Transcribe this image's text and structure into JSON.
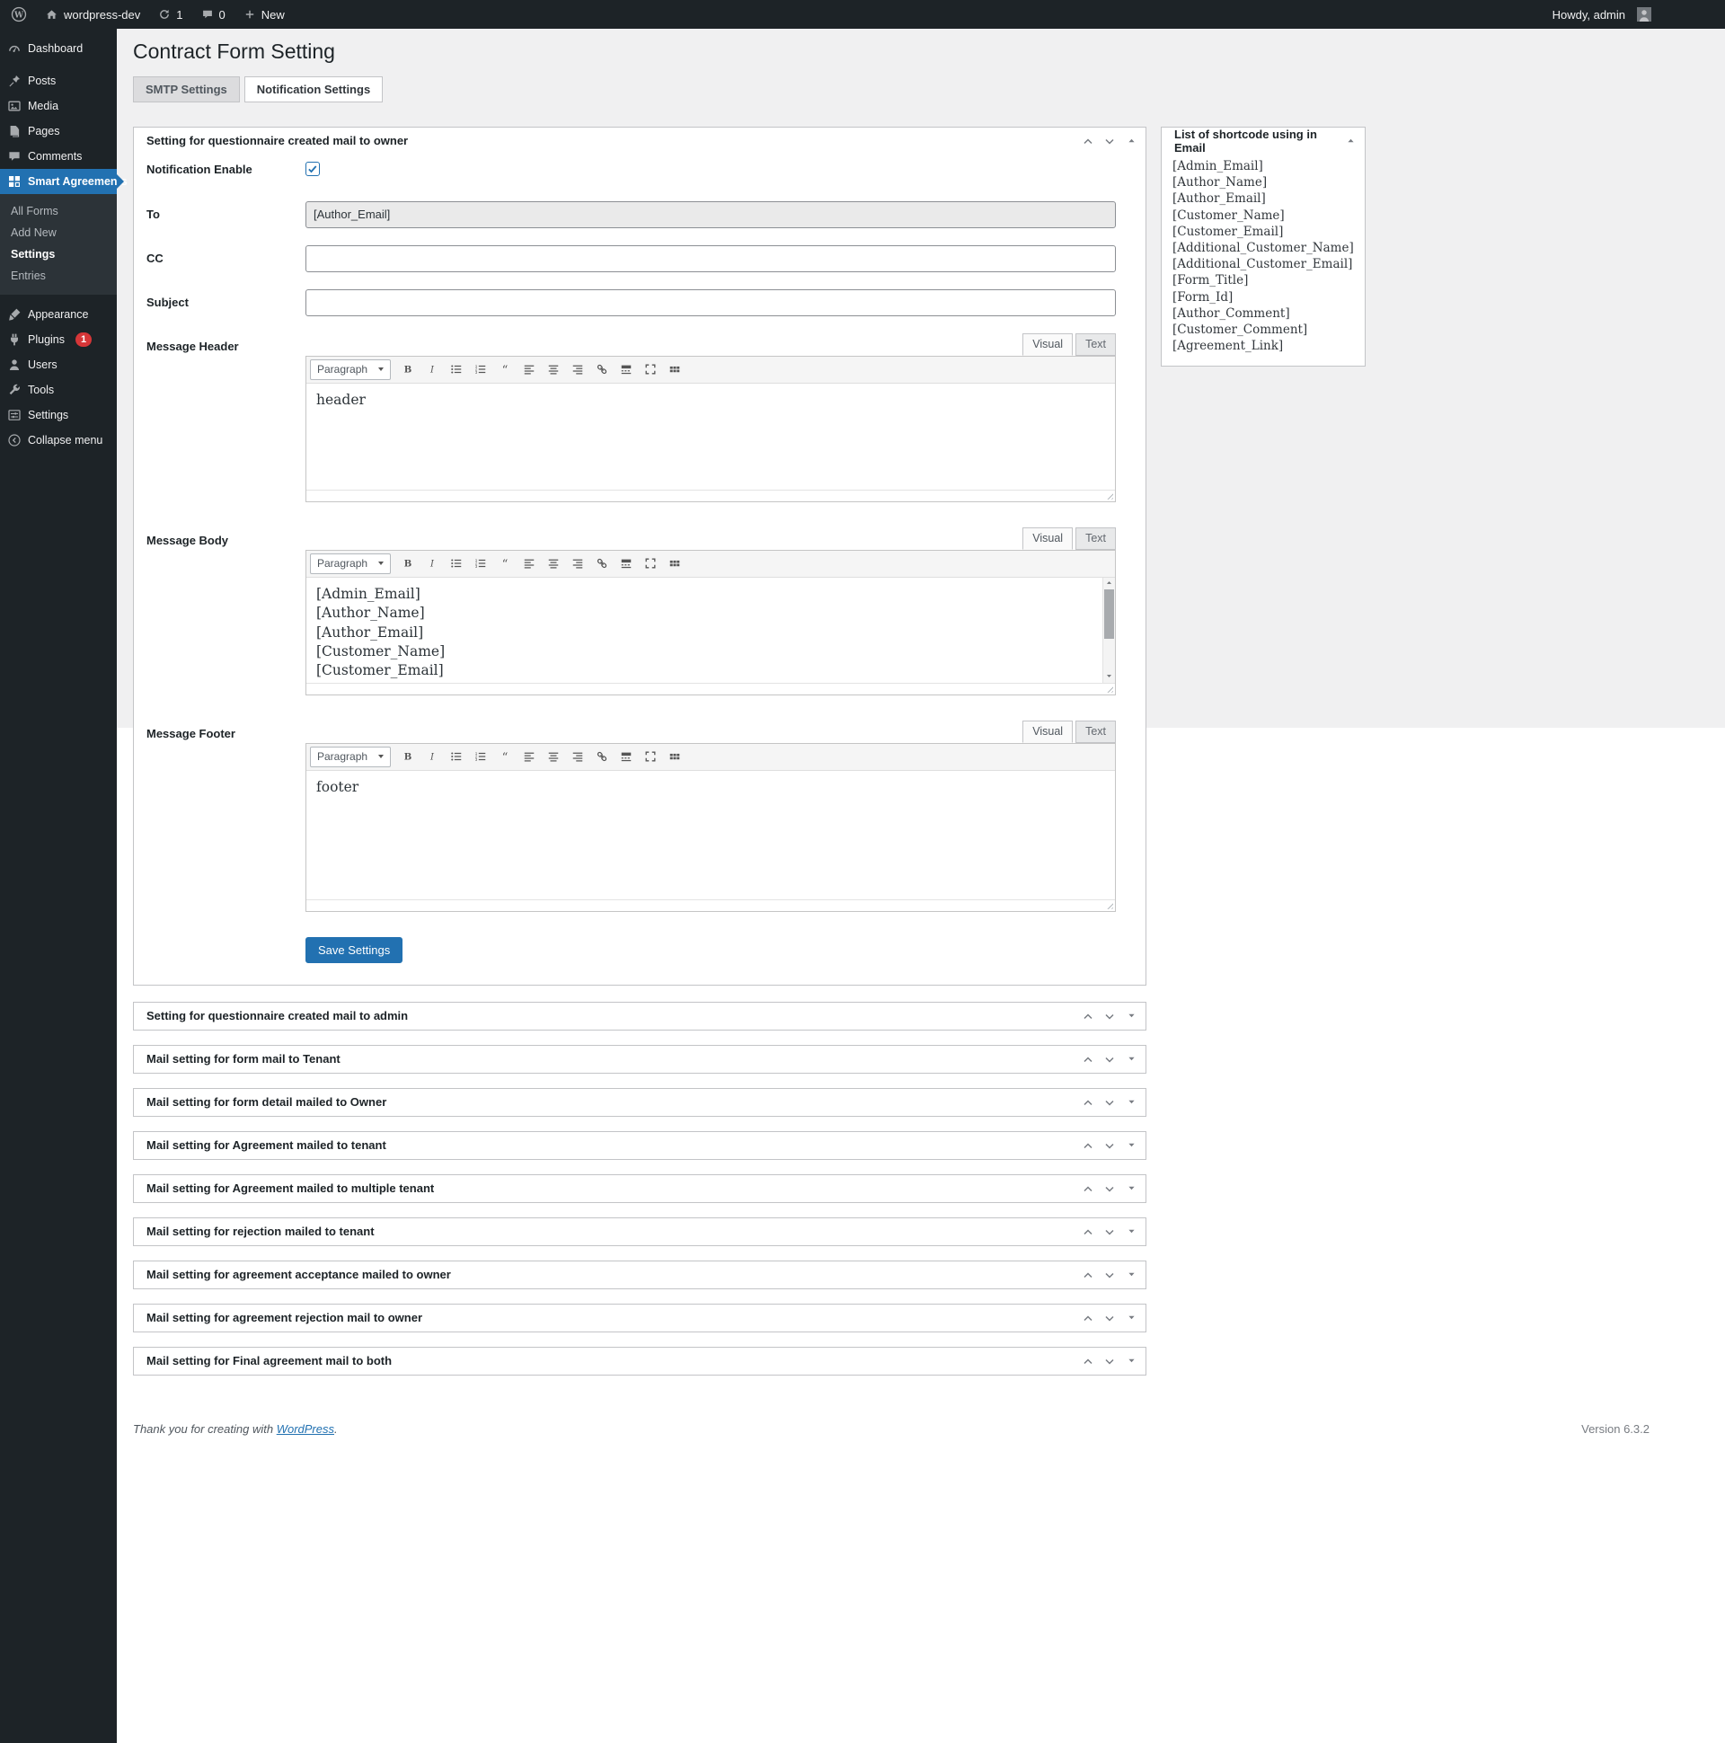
{
  "admin_bar": {
    "site_name": "wordpress-dev",
    "update_count": "1",
    "comment_count": "0",
    "new_label": "New",
    "howdy": "Howdy, admin"
  },
  "sidebar": {
    "items": [
      {
        "label": "Dashboard",
        "icon": "dashboard-icon"
      },
      {
        "label": "Posts",
        "icon": "posts-icon"
      },
      {
        "label": "Media",
        "icon": "media-icon"
      },
      {
        "label": "Pages",
        "icon": "pages-icon"
      },
      {
        "label": "Comments",
        "icon": "comments-icon"
      },
      {
        "label": "Smart Agreements",
        "icon": "smart-agreements-icon",
        "active": true,
        "submenu": [
          "All Forms",
          "Add New",
          "Settings",
          "Entries"
        ],
        "active_submenu_item": "Settings"
      },
      {
        "label": "Appearance",
        "icon": "appearance-icon"
      },
      {
        "label": "Plugins",
        "icon": "plugins-icon",
        "badge": "1"
      },
      {
        "label": "Users",
        "icon": "users-icon"
      },
      {
        "label": "Tools",
        "icon": "tools-icon"
      },
      {
        "label": "Settings",
        "icon": "settings-icon"
      },
      {
        "label": "Collapse menu",
        "icon": "collapse-icon"
      }
    ]
  },
  "page": {
    "title": "Contract Form Setting",
    "tabs": [
      {
        "label": "SMTP Settings",
        "active": false
      },
      {
        "label": "Notification Settings",
        "active": true
      }
    ]
  },
  "main_panel": {
    "title": "Setting for questionnaire created mail to owner",
    "fields": [
      {
        "name": "notification-enable",
        "type": "checkbox",
        "label": "Notification Enable",
        "checked": true
      },
      {
        "name": "to",
        "type": "text",
        "label": "To",
        "value": "[Author_Email]",
        "readonly": true
      },
      {
        "name": "cc",
        "type": "text",
        "label": "CC",
        "value": ""
      },
      {
        "name": "subject",
        "type": "text",
        "label": "Subject",
        "value": ""
      }
    ],
    "editor_ui": {
      "visual_label": "Visual",
      "text_label": "Text",
      "paragraph_label": "Paragraph",
      "toolbar_icons": [
        "bold-icon",
        "italic-icon",
        "bulleted-list-icon",
        "numbered-list-icon",
        "blockquote-icon",
        "align-left-icon",
        "align-center-icon",
        "align-right-icon",
        "link-icon",
        "read-more-icon",
        "fullscreen-icon",
        "toolbar-toggle-icon"
      ]
    },
    "editors": [
      {
        "name": "message-header",
        "label": "Message Header",
        "content_lines": [
          "header"
        ],
        "has_scrollbar": false
      },
      {
        "name": "message-body",
        "label": "Message Body",
        "content_lines": [
          "[Admin_Email]",
          "[Author_Name]",
          "[Author_Email]",
          "[Customer_Name]",
          "[Customer_Email]"
        ],
        "has_scrollbar": true
      },
      {
        "name": "message-footer",
        "label": "Message Footer",
        "content_lines": [
          "footer"
        ],
        "has_scrollbar": false
      }
    ],
    "save_button": "Save Settings"
  },
  "shortcode_panel": {
    "title": "List of shortcode using in Email",
    "items": [
      "[Admin_Email]",
      "[Author_Name]",
      "[Author_Email]",
      "[Customer_Name]",
      "[Customer_Email]",
      "[Additional_Customer_Name]",
      "[Additional_Customer_Email]",
      "[Form_Title]",
      "[Form_Id]",
      "[Author_Comment]",
      "[Customer_Comment]",
      "[Agreement_Link]"
    ]
  },
  "collapsed_panels": [
    "Setting for questionnaire created mail to admin",
    "Mail setting for form mail to Tenant",
    "Mail setting for form detail mailed to Owner",
    "Mail setting for Agreement mailed to tenant",
    "Mail setting for Agreement mailed to multiple tenant",
    "Mail setting for rejection mailed to tenant",
    "Mail setting for agreement acceptance mailed to owner",
    "Mail setting for agreement rejection mail to owner",
    "Mail setting for Final agreement mail to both"
  ],
  "footer": {
    "thanks_prefix": "Thank you for creating with ",
    "wordpress_link": "WordPress",
    "thanks_suffix": ".",
    "version": "Version 6.3.2"
  },
  "colors": {
    "accent": "#2271b1",
    "admin_bar_bg": "#1d2327",
    "sidebar_bg": "#1d2327",
    "submenu_bg": "#2c3338",
    "badge_red": "#d63638",
    "content_bg": "#f0f0f1",
    "panel_border": "#c3c4c7"
  }
}
